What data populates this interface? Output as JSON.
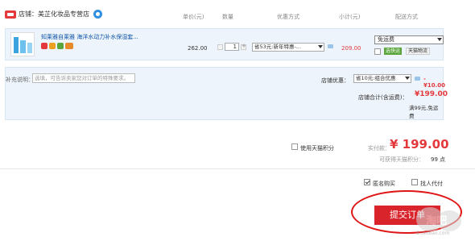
{
  "shop": {
    "label": "店铺：美芷化妆品专营店"
  },
  "columns": {
    "unit_price": "单价(元)",
    "quantity": "数量",
    "promotion": "优惠方式",
    "subtotal": "小计(元)",
    "shipping": "配送方式"
  },
  "item": {
    "title": "知莱雅自莱雅  海洋水动力补水保湿套...",
    "price": "262.00",
    "quantity": "1",
    "promotion_selected": "省53元:新年特惠-...",
    "subtotal": "209.00",
    "shipping_selected": "免运费",
    "shipping_tag_green": "选快运",
    "shipping_tag_gray": "天猫物流"
  },
  "order_note": {
    "label": "补充说明：",
    "placeholder": "选填，可告诉卖家您对订单的特殊要求。"
  },
  "shop_promo": {
    "label": "店铺优惠：",
    "selected": "省10元:组合优惠",
    "amount": "-¥10.00"
  },
  "shop_total": {
    "label": "店铺合计(含运费)：",
    "amount": "¥199.00",
    "free_shipping_note": "满99元,免运费"
  },
  "tmall_points": {
    "label": "使用天猫积分"
  },
  "payable": {
    "label": "实付款：",
    "amount": "¥ 199.00",
    "earn_label": "可获得天猫积分：",
    "earn_points": "99 点"
  },
  "options": {
    "anonymous_label": "匿名购买",
    "anonymous_checked": true,
    "proxy_pay_label": "找人代付",
    "proxy_pay_checked": false
  },
  "submit": {
    "label": "提交订单"
  },
  "watermark": {
    "brand": "淘吧",
    "url": "8.taobao.com"
  },
  "colors": {
    "accent_red": "#e4393c",
    "submit_red": "#d9242c",
    "link_blue": "#1155aa",
    "row_bg": "#eef4fb"
  }
}
